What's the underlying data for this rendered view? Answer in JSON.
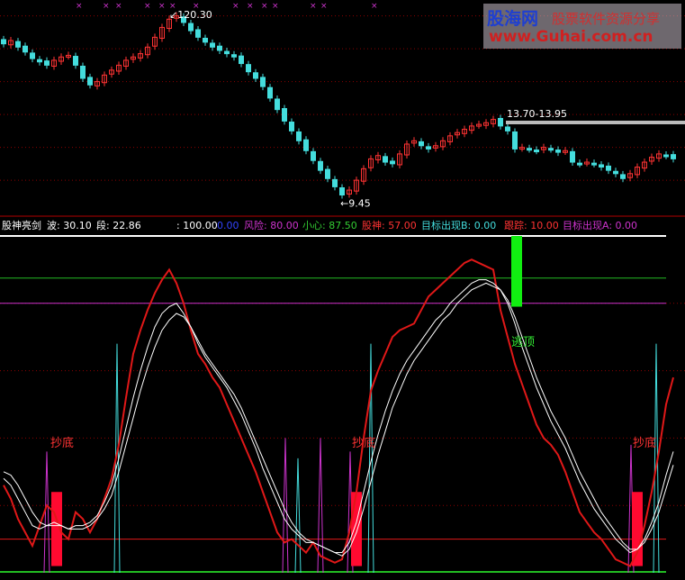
{
  "colors": {
    "up": "#ff3333",
    "down": "#44dddd",
    "red_line": "#e01818",
    "white_line": "#ffffff",
    "green_line": "#22bb22",
    "magenta_line": "#cc33cc",
    "cyan_spike": "#44dddd",
    "magenta_spike": "#cc33cc",
    "red_bar": "#ff0a30",
    "green_bar": "#11ee11",
    "grid": "#8b0000",
    "separator": "#b00000"
  },
  "price_panel": {
    "high_label": "120.30",
    "low_label": "9.45",
    "range_label": "13.70-13.95",
    "high_arrow": "↙",
    "low_arrow": "←",
    "x_marks": [
      "×",
      "×",
      "×",
      "×",
      "×",
      "×",
      "×",
      "×",
      "×",
      "×",
      "×",
      "×",
      "×",
      "×"
    ]
  },
  "indicator_header": {
    "name": "股神亮剑",
    "items": [
      {
        "label": "波:",
        "value": "30.10",
        "color": "#ffffff"
      },
      {
        "label": "段:",
        "value": "22.86",
        "color": "#ffffff"
      },
      {
        "label": ":",
        "value": "100.00",
        "color": "#ffffff"
      },
      {
        "label": "",
        "value": "0.00",
        "color": "#3344ff"
      },
      {
        "label": "风险:",
        "value": "80.00",
        "color": "#cc33cc"
      },
      {
        "label": "小心:",
        "value": "87.50",
        "color": "#33cc33"
      },
      {
        "label": "股神:",
        "value": "57.00",
        "color": "#ff3333"
      },
      {
        "label": "目标出现B:",
        "value": "0.00",
        "color": "#44dddd"
      },
      {
        "label": "跟踪:",
        "value": "10.00",
        "color": "#ff3333"
      },
      {
        "label": "目标出现A:",
        "value": "0.00",
        "color": "#cc33cc"
      }
    ]
  },
  "annotations": {
    "buy_label": "抄底",
    "escape_label": "逃顶"
  },
  "watermark": {
    "title": "股海网",
    "subtitle": "股票软件资源分享",
    "url": "www.Guhai.com.cn"
  },
  "chart_data": [
    {
      "type": "candlestick",
      "title": "",
      "high_marker": 120.3,
      "low_marker": 9.45,
      "range_marker": [
        13.7,
        13.95
      ],
      "x": [
        0,
        8,
        16,
        24,
        32,
        40,
        48,
        56,
        64,
        72,
        80,
        88,
        96,
        104,
        112,
        120,
        128,
        136,
        144,
        152,
        160,
        168,
        176,
        184,
        192,
        200,
        208,
        216,
        224,
        232,
        240,
        248,
        256,
        264,
        272,
        280,
        288,
        296,
        304,
        312,
        320,
        328,
        336,
        344,
        352,
        360,
        368,
        376,
        384,
        392,
        400,
        408,
        416,
        424,
        432,
        440,
        448,
        456,
        464,
        472,
        480,
        488,
        496,
        504,
        512,
        520,
        528,
        536,
        544,
        552,
        560,
        568,
        576,
        584,
        592,
        600,
        608,
        616,
        624,
        632,
        640,
        648,
        656,
        664,
        672,
        680,
        688,
        696,
        704,
        712,
        720,
        728,
        736,
        744
      ],
      "close": [
        103,
        105,
        101,
        98,
        94,
        92,
        90,
        93,
        95,
        96,
        90,
        82,
        78,
        80,
        84,
        87,
        90,
        93,
        95,
        97,
        101,
        107,
        113,
        118,
        120,
        116,
        111,
        107,
        104,
        101,
        99,
        97,
        95,
        91,
        86,
        82,
        77,
        70,
        63,
        56,
        50,
        44,
        38,
        32,
        26,
        21,
        16,
        11,
        14,
        20,
        27,
        33,
        35,
        31,
        30,
        36,
        42,
        44,
        41,
        39,
        41,
        44,
        47,
        49,
        51,
        53,
        54,
        55,
        57,
        53,
        50,
        39,
        40,
        39,
        38,
        40,
        39,
        37,
        38,
        31,
        30,
        31,
        30,
        28,
        26,
        24,
        21,
        24,
        28,
        31,
        34,
        36,
        35,
        33
      ]
    },
    {
      "type": "line",
      "title": "",
      "ylim": [
        0,
        100
      ],
      "levels": {
        "top_white": 100,
        "green": 87.5,
        "magenta": 80,
        "red": 10
      },
      "x": [
        0,
        8,
        16,
        24,
        32,
        40,
        48,
        56,
        64,
        72,
        80,
        88,
        96,
        104,
        112,
        120,
        128,
        136,
        144,
        152,
        160,
        168,
        176,
        184,
        192,
        200,
        208,
        216,
        224,
        232,
        240,
        248,
        256,
        264,
        272,
        280,
        288,
        296,
        304,
        312,
        320,
        328,
        336,
        344,
        352,
        360,
        368,
        376,
        384,
        392,
        400,
        408,
        416,
        424,
        432,
        440,
        448,
        456,
        464,
        472,
        480,
        488,
        496,
        504,
        512,
        520,
        528,
        536,
        544,
        552,
        560,
        568,
        576,
        584,
        592,
        600,
        608,
        616,
        624,
        632,
        640,
        648,
        656,
        664,
        672,
        680,
        688,
        696,
        704,
        712,
        720,
        728,
        736,
        744
      ],
      "series": [
        {
          "color": "red",
          "values": [
            26,
            22,
            16,
            12,
            8,
            14,
            20,
            18,
            12,
            10,
            18,
            16,
            12,
            16,
            22,
            28,
            38,
            52,
            65,
            72,
            78,
            83,
            87,
            90,
            86,
            80,
            72,
            65,
            62,
            58,
            55,
            50,
            45,
            40,
            35,
            30,
            24,
            18,
            12,
            9,
            10,
            8,
            6,
            9,
            5,
            4,
            3,
            4,
            12,
            24,
            40,
            54,
            60,
            65,
            70,
            72,
            73,
            74,
            78,
            82,
            84,
            86,
            88,
            90,
            92,
            93,
            92,
            91,
            90,
            78,
            70,
            62,
            56,
            50,
            44,
            40,
            38,
            35,
            30,
            24,
            18,
            15,
            12,
            10,
            7,
            4,
            3,
            2,
            6,
            14,
            24,
            36,
            50,
            58
          ]
        },
        {
          "color": "white",
          "values": [
            28,
            26,
            22,
            18,
            14,
            13,
            14,
            15,
            14,
            13,
            14,
            14,
            15,
            17,
            21,
            26,
            34,
            43,
            52,
            60,
            67,
            73,
            77,
            79,
            80,
            77,
            73,
            68,
            64,
            61,
            58,
            55,
            51,
            47,
            42,
            37,
            31,
            26,
            21,
            16,
            13,
            11,
            9,
            9,
            8,
            7,
            6,
            6,
            9,
            15,
            24,
            33,
            41,
            48,
            54,
            59,
            63,
            66,
            69,
            72,
            75,
            77,
            80,
            82,
            84,
            86,
            87,
            87,
            86,
            84,
            80,
            74,
            67,
            61,
            55,
            50,
            45,
            41,
            37,
            32,
            27,
            23,
            19,
            16,
            13,
            10,
            8,
            6,
            7,
            10,
            15,
            21,
            29,
            36
          ]
        },
        {
          "color": "white",
          "values": [
            30,
            29,
            26,
            22,
            18,
            15,
            14,
            14,
            14,
            13,
            13,
            13,
            14,
            16,
            19,
            23,
            30,
            38,
            46,
            54,
            61,
            67,
            72,
            75,
            77,
            76,
            73,
            69,
            65,
            62,
            59,
            56,
            53,
            49,
            44,
            39,
            34,
            29,
            24,
            19,
            15,
            12,
            10,
            9,
            8,
            7,
            6,
            5,
            7,
            12,
            19,
            27,
            35,
            42,
            49,
            54,
            59,
            63,
            66,
            69,
            72,
            75,
            77,
            80,
            82,
            84,
            85,
            86,
            85,
            84,
            81,
            76,
            70,
            64,
            58,
            53,
            48,
            44,
            40,
            35,
            30,
            26,
            22,
            18,
            15,
            12,
            9,
            7,
            7,
            9,
            13,
            18,
            25,
            32
          ]
        }
      ],
      "magenta_spikes": [
        {
          "x": 48,
          "height": 36
        },
        {
          "x": 313,
          "height": 40
        },
        {
          "x": 352,
          "height": 40
        },
        {
          "x": 385,
          "height": 36
        },
        {
          "x": 697,
          "height": 38
        }
      ],
      "cyan_spikes": [
        {
          "x": 126,
          "height": 68
        },
        {
          "x": 327,
          "height": 34
        },
        {
          "x": 408,
          "height": 68
        },
        {
          "x": 725,
          "height": 68
        }
      ],
      "red_bars": [
        {
          "x": 59,
          "from": 2,
          "to": 24
        },
        {
          "x": 392,
          "from": 2,
          "to": 24
        },
        {
          "x": 704,
          "from": 2,
          "to": 24
        }
      ],
      "green_bars": [
        {
          "x": 570,
          "from": 79,
          "to": 100
        }
      ]
    }
  ]
}
